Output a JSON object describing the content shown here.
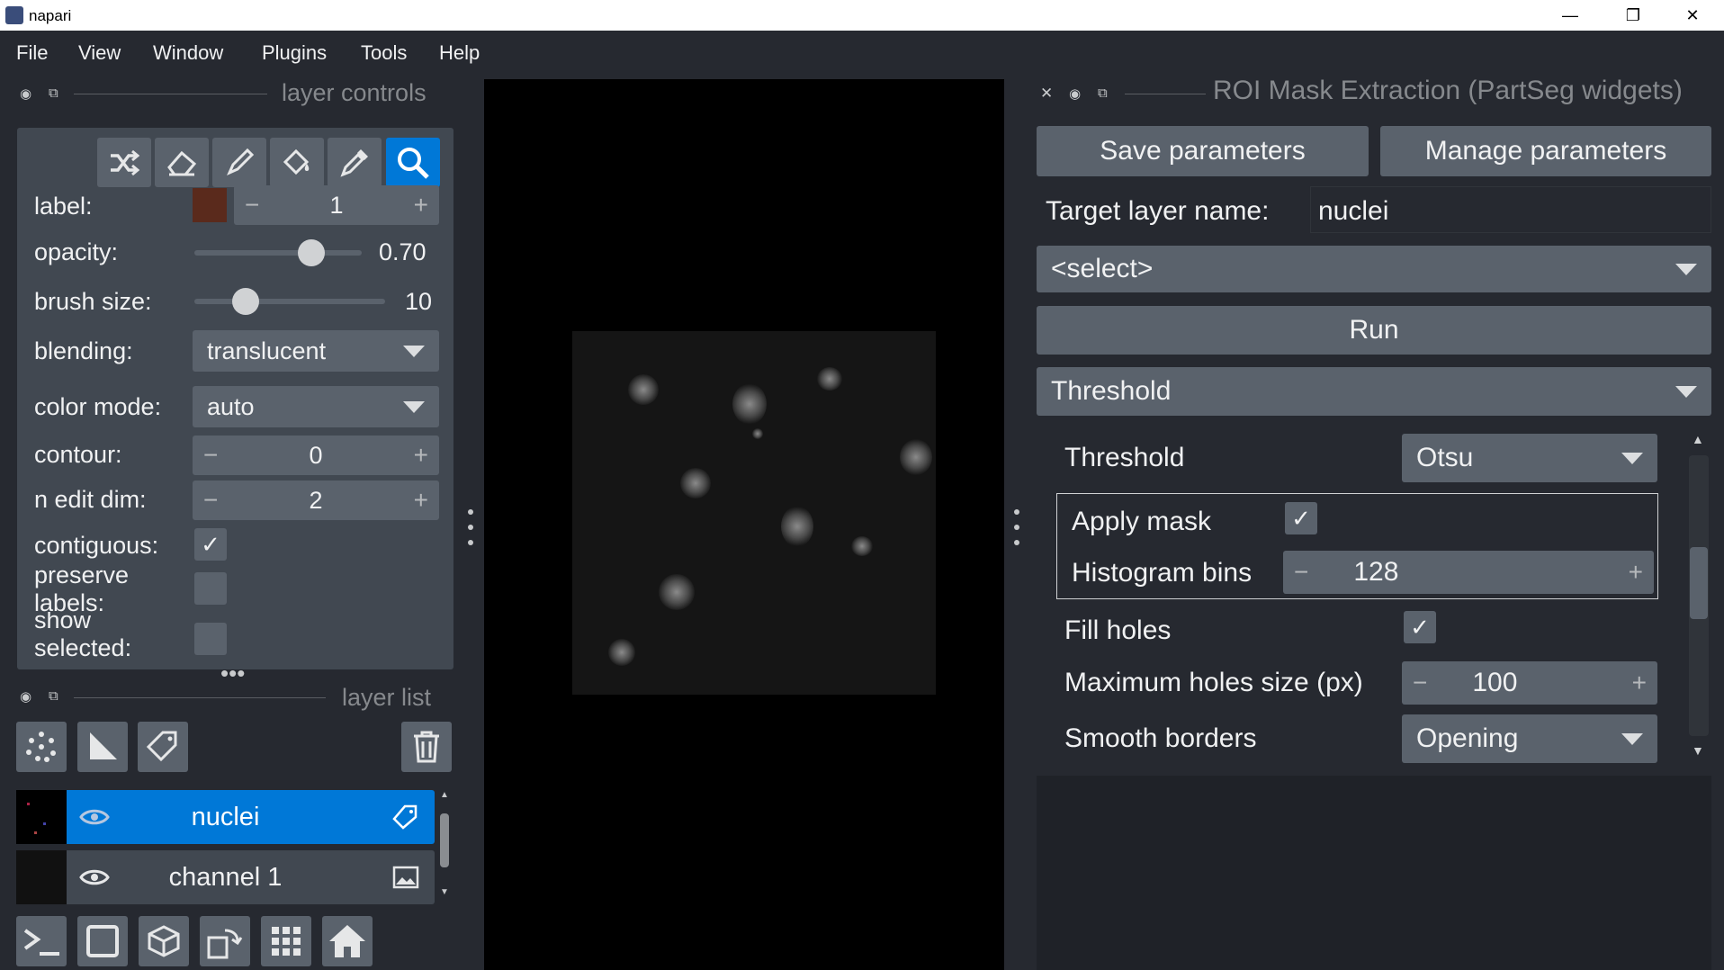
{
  "window": {
    "title": "napari",
    "minimize": "—",
    "restore": "❐",
    "close": "✕"
  },
  "menu": [
    "File",
    "View",
    "Window",
    "Plugins",
    "Tools",
    "Help"
  ],
  "layer_controls": {
    "header": "layer controls",
    "label_label": "label:",
    "label_value": "1",
    "label_color": "#5a2a1c",
    "opacity_label": "opacity:",
    "opacity_value": "0.70",
    "opacity_level": 0.7,
    "brush_label": "brush size:",
    "brush_value": "10",
    "blending_label": "blending:",
    "blending_value": "translucent",
    "color_mode_label": "color mode:",
    "color_mode_value": "auto",
    "contour_label": "contour:",
    "contour_value": "0",
    "n_edit_label": "n edit dim:",
    "n_edit_value": "2",
    "contiguous_label": "contiguous:",
    "contiguous_checked": true,
    "preserve_label_1": "preserve",
    "preserve_label_2": "labels:",
    "show_label_1": "show",
    "show_label_2": "selected:"
  },
  "layer_list": {
    "header": "layer list",
    "layers": [
      {
        "name": "nuclei",
        "selected": true
      },
      {
        "name": "channel 1",
        "selected": false
      }
    ]
  },
  "roi_widget": {
    "header": "ROI Mask Extraction (PartSeg widgets)",
    "save_parameters": "Save parameters",
    "manage_parameters": "Manage parameters",
    "target_label": "Target layer name:",
    "target_value": "nuclei",
    "select_value": "<select>",
    "run": "Run",
    "algorithm": "Threshold",
    "threshold_label": "Threshold",
    "threshold_value": "Otsu",
    "apply_mask_label": "Apply mask",
    "apply_mask_checked": true,
    "hist_bins_label": "Histogram bins",
    "hist_bins_value": "128",
    "fill_holes_label": "Fill holes",
    "fill_holes_checked": true,
    "max_holes_label": "Maximum holes size (px)",
    "max_holes_value": "100",
    "smooth_label": "Smooth borders",
    "smooth_value": "Opening"
  },
  "colors": {
    "accent": "#0078d7",
    "background": "#262930",
    "panel": "#414851"
  }
}
